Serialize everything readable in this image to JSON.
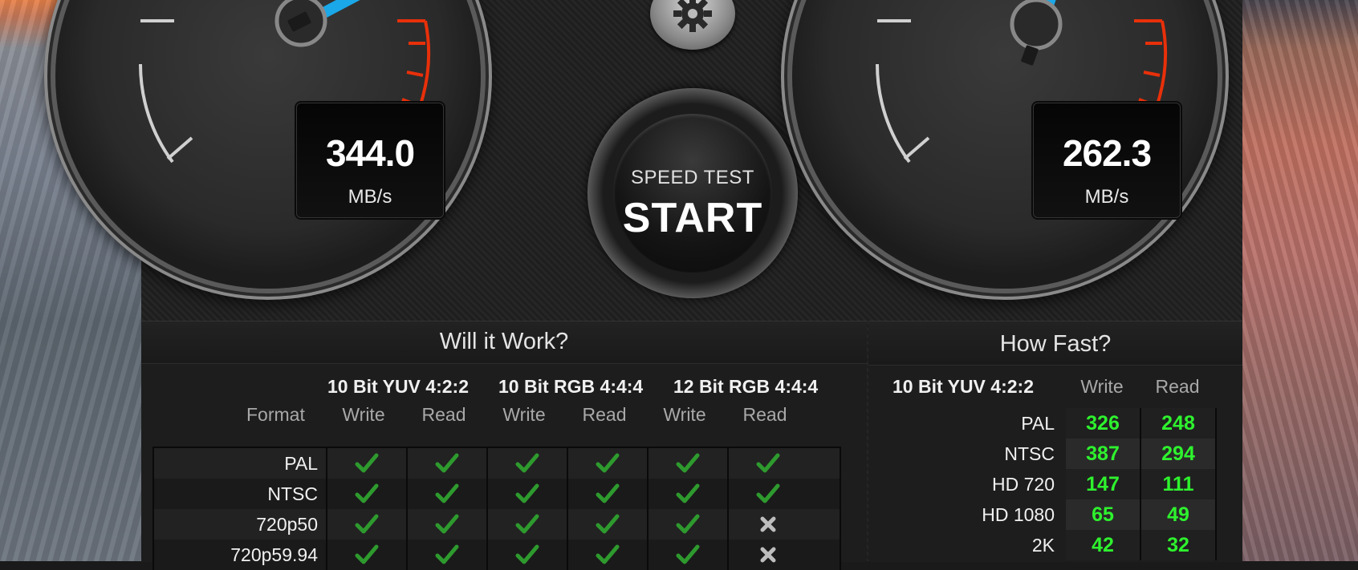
{
  "gauges": {
    "write": {
      "value": "344.0",
      "unit": "MB/s"
    },
    "read": {
      "value": "262.3",
      "unit": "MB/s"
    }
  },
  "start_button": {
    "sub_label": "SPEED TEST",
    "label": "START"
  },
  "will_it_work": {
    "title": "Will it Work?",
    "format_label": "Format",
    "groups": [
      "10 Bit YUV 4:2:2",
      "10 Bit RGB 4:4:4",
      "12 Bit RGB 4:4:4"
    ],
    "subcols": [
      "Write",
      "Read",
      "Write",
      "Read",
      "Write",
      "Read"
    ],
    "rows": [
      {
        "format": "PAL",
        "results": [
          "check",
          "check",
          "check",
          "check",
          "check",
          "check"
        ]
      },
      {
        "format": "NTSC",
        "results": [
          "check",
          "check",
          "check",
          "check",
          "check",
          "check"
        ]
      },
      {
        "format": "720p50",
        "results": [
          "check",
          "check",
          "check",
          "check",
          "check",
          "cross"
        ]
      },
      {
        "format": "720p59.94",
        "results": [
          "check",
          "check",
          "check",
          "check",
          "check",
          "cross"
        ]
      }
    ]
  },
  "how_fast": {
    "title": "How Fast?",
    "group": "10 Bit YUV 4:2:2",
    "subcols": [
      "Write",
      "Read"
    ],
    "rows": [
      {
        "format": "PAL",
        "write": "326",
        "read": "248"
      },
      {
        "format": "NTSC",
        "write": "387",
        "read": "294"
      },
      {
        "format": "HD 720",
        "write": "147",
        "read": "111"
      },
      {
        "format": "HD 1080",
        "write": "65",
        "read": "49"
      },
      {
        "format": "2K",
        "write": "42",
        "read": "32"
      }
    ]
  },
  "colors": {
    "needle": "#1aa8e8",
    "redline": "#e8300a",
    "fast_value": "#2ef22e",
    "check": "#2e9a2e"
  }
}
